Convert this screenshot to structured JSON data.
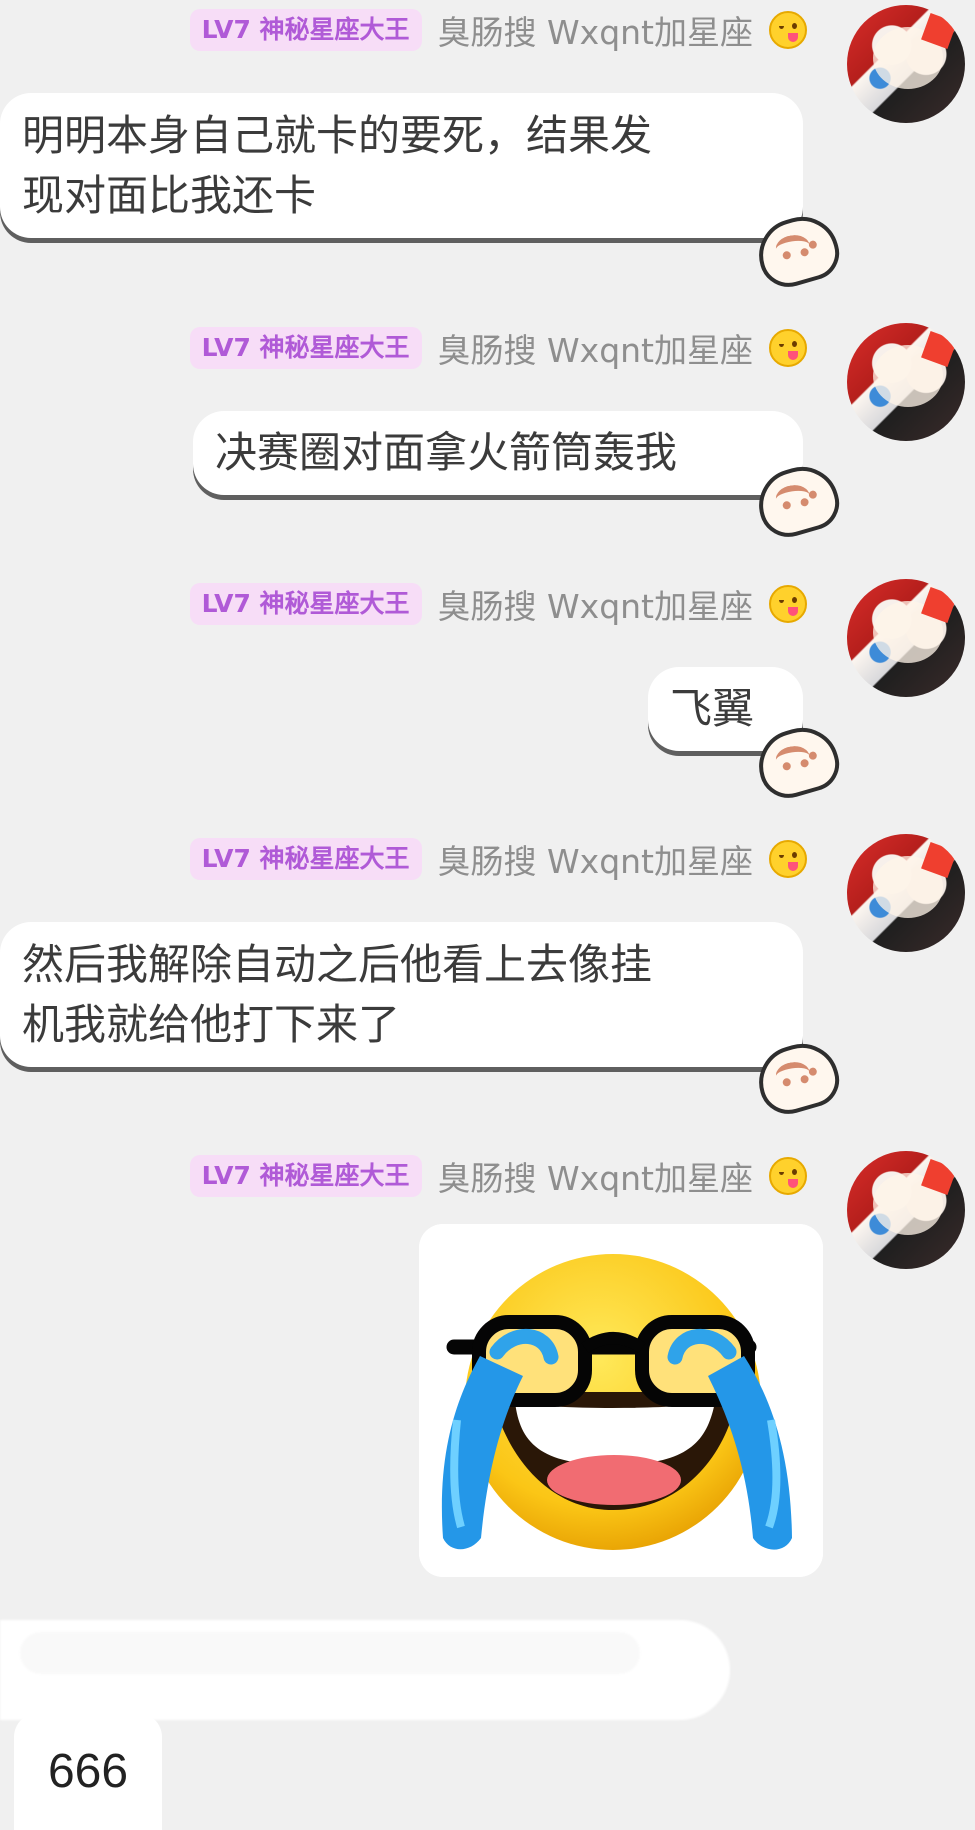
{
  "messages": [
    {
      "level": "LV7 神秘星座大王",
      "username": "臭肠搜 Wxqnt加星座",
      "emoji": "yum-face-icon",
      "text": "明明本身自己就卡的要死，结果发\n现对面比我还卡"
    },
    {
      "level": "LV7 神秘星座大王",
      "username": "臭肠搜 Wxqnt加星座",
      "emoji": "yum-face-icon",
      "text": "决赛圈对面拿火箭筒轰我"
    },
    {
      "level": "LV7 神秘星座大王",
      "username": "臭肠搜 Wxqnt加星座",
      "emoji": "yum-face-icon",
      "text": "飞翼"
    },
    {
      "level": "LV7 神秘星座大王",
      "username": "臭肠搜 Wxqnt加星座",
      "emoji": "yum-face-icon",
      "text": "然后我解除自动之后他看上去像挂\n机我就给他打下来了"
    },
    {
      "level": "LV7 神秘星座大王",
      "username": "臭肠搜 Wxqnt加星座",
      "emoji": "yum-face-icon",
      "sticker": "crying-laughing-glasses-emoji"
    }
  ],
  "incoming_message": {
    "text": "666"
  },
  "colors": {
    "background": "#f0f0f0",
    "badge_background": "#f7ddf7",
    "badge_text": "#b05ad7",
    "username": "#8e8e8e",
    "bubble": "#ffffff",
    "bubble_shadow": "#5f5f5f"
  }
}
